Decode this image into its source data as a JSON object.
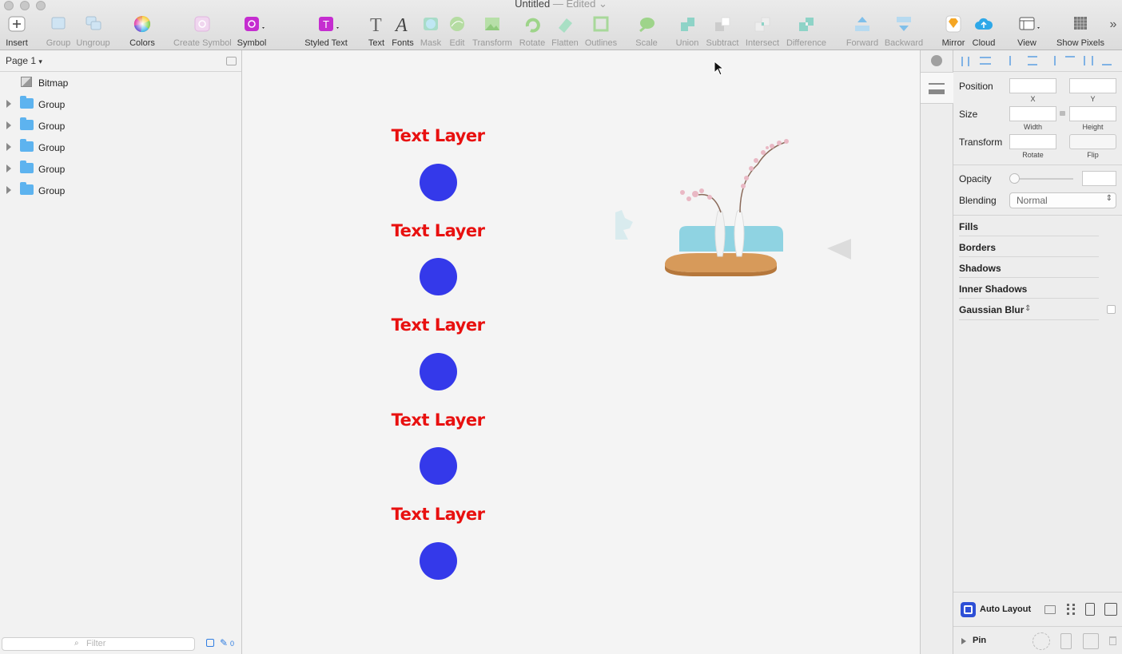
{
  "window": {
    "title": "Untitled",
    "status": "— Edited"
  },
  "toolbar": {
    "items": [
      {
        "label": "Insert",
        "icon": "plus-icon",
        "enabled": true
      },
      {
        "label": "Group",
        "icon": "group-icon",
        "enabled": false
      },
      {
        "label": "Ungroup",
        "icon": "ungroup-icon",
        "enabled": false
      },
      {
        "label": "Colors",
        "icon": "color-wheel-icon",
        "enabled": true
      },
      {
        "label": "Create Symbol",
        "icon": "create-symbol-icon",
        "enabled": false
      },
      {
        "label": "Symbol",
        "icon": "symbol-icon",
        "enabled": true
      },
      {
        "label": "Styled Text",
        "icon": "styled-text-icon",
        "enabled": true
      },
      {
        "label": "Text",
        "icon": "text-icon",
        "enabled": true
      },
      {
        "label": "Fonts",
        "icon": "fonts-icon",
        "enabled": true
      },
      {
        "label": "Mask",
        "icon": "mask-icon",
        "enabled": false
      },
      {
        "label": "Edit",
        "icon": "edit-icon",
        "enabled": false
      },
      {
        "label": "Transform",
        "icon": "transform-icon",
        "enabled": false
      },
      {
        "label": "Rotate",
        "icon": "rotate-icon",
        "enabled": false
      },
      {
        "label": "Flatten",
        "icon": "flatten-icon",
        "enabled": false
      },
      {
        "label": "Outlines",
        "icon": "outlines-icon",
        "enabled": false
      },
      {
        "label": "Scale",
        "icon": "scale-icon",
        "enabled": false
      },
      {
        "label": "Union",
        "icon": "union-icon",
        "enabled": false
      },
      {
        "label": "Subtract",
        "icon": "subtract-icon",
        "enabled": false
      },
      {
        "label": "Intersect",
        "icon": "intersect-icon",
        "enabled": false
      },
      {
        "label": "Difference",
        "icon": "difference-icon",
        "enabled": false
      },
      {
        "label": "Forward",
        "icon": "forward-icon",
        "enabled": false
      },
      {
        "label": "Backward",
        "icon": "backward-icon",
        "enabled": false
      },
      {
        "label": "Mirror",
        "icon": "mirror-icon",
        "enabled": true
      },
      {
        "label": "Cloud",
        "icon": "cloud-icon",
        "enabled": true
      },
      {
        "label": "View",
        "icon": "view-icon",
        "enabled": true
      },
      {
        "label": "Show Pixels",
        "icon": "show-pixels-icon",
        "enabled": true
      }
    ]
  },
  "layers_panel": {
    "page": "Page 1",
    "layers": [
      {
        "name": "Bitmap",
        "type": "bitmap"
      },
      {
        "name": "Group",
        "type": "group"
      },
      {
        "name": "Group",
        "type": "group"
      },
      {
        "name": "Group",
        "type": "group"
      },
      {
        "name": "Group",
        "type": "group"
      },
      {
        "name": "Group",
        "type": "group"
      }
    ],
    "filter_placeholder": "Filter",
    "count": "0"
  },
  "canvas": {
    "text_layers": [
      "Text Layer",
      "Text Layer",
      "Text Layer",
      "Text Layer",
      "Text Layer"
    ],
    "text_color": "#e8100f",
    "circle_color": "#3439ea"
  },
  "inspector": {
    "position_label": "Position",
    "x_label": "X",
    "y_label": "Y",
    "size_label": "Size",
    "width_label": "Width",
    "height_label": "Height",
    "transform_label": "Transform",
    "rotate_label": "Rotate",
    "flip_label": "Flip",
    "opacity_label": "Opacity",
    "blending_label": "Blending",
    "blending_value": "Normal",
    "sections": [
      "Fills",
      "Borders",
      "Shadows",
      "Inner Shadows",
      "Gaussian Blur"
    ],
    "auto_layout": "Auto Layout",
    "pin": "Pin"
  }
}
